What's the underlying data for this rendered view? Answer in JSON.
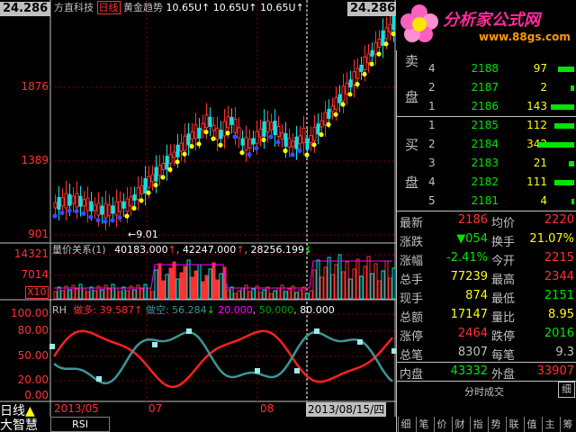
{
  "header": {
    "title_main": "方直科技",
    "title_period": "日线",
    "title_indicator": "黄金趋势",
    "title_values": [
      "10.65U↑",
      "10.65U↑",
      "10.65U↑"
    ],
    "top_left_badge": "24.286",
    "top_right_badge": "24.286"
  },
  "watermark": {
    "title": "分析家公式网",
    "url": "www.88gs.com"
  },
  "price_axis": [
    "1876",
    "1389",
    "901"
  ],
  "low_marker": "←9.01",
  "volume_panel": {
    "title": "量价关系(1)",
    "v1": "40183.000",
    "v2": "42247.000",
    "v3": "28256.199",
    "axis_top": "14321",
    "axis_mid": "7014",
    "axis_unit": "X10"
  },
  "rsi_panel": {
    "name": "RH",
    "label1": "做多:",
    "value1": "39.587",
    "label2": "做空:",
    "value2": "56.284",
    "v3": "20.000",
    "v4": "50.000",
    "v5": "80.000",
    "axis": [
      "100.00",
      "80.00",
      "50.00",
      "20.00",
      "0.00"
    ]
  },
  "bottom": {
    "period_label": "日线",
    "company_label": "大智慧",
    "indicator_tab": "RSI",
    "date1": "2013/05",
    "date2": "07",
    "date3": "08",
    "cursor_date": "2013/08/15/四"
  },
  "order_book": {
    "sell_label": [
      "卖",
      "盘"
    ],
    "buy_label": [
      "买",
      "盘"
    ],
    "sell": [
      {
        "level": "4",
        "price": "2188",
        "volume": "97",
        "bar": 18
      },
      {
        "level": "2",
        "price": "2187",
        "volume": "2",
        "bar": 4
      },
      {
        "level": "1",
        "price": "2186",
        "volume": "143",
        "bar": 26
      }
    ],
    "buy": [
      {
        "level": "1",
        "price": "2185",
        "volume": "112",
        "bar": 22
      },
      {
        "level": "2",
        "price": "2184",
        "volume": "342",
        "bar": 40
      },
      {
        "level": "3",
        "price": "2183",
        "volume": "21",
        "bar": 6
      },
      {
        "level": "4",
        "price": "2182",
        "volume": "111",
        "bar": 22
      },
      {
        "level": "5",
        "price": "2181",
        "volume": "4",
        "bar": 3
      }
    ]
  },
  "stats": [
    {
      "l1": "最新",
      "v1": "2186",
      "c1": "red",
      "l2": "均价",
      "v2": "2220",
      "c2": "red"
    },
    {
      "l1": "涨跌",
      "v1": "▼054",
      "c1": "green",
      "l2": "换手",
      "v2": "21.07%",
      "c2": "yellow"
    },
    {
      "l1": "涨幅",
      "v1": "-2.41%",
      "c1": "green",
      "l2": "今开",
      "v2": "2215",
      "c2": "red"
    },
    {
      "l1": "总手",
      "v1": "77239",
      "c1": "yellow",
      "l2": "最高",
      "v2": "2344",
      "c2": "red"
    },
    {
      "l1": "现手",
      "v1": "874",
      "c1": "yellow",
      "l2": "最低",
      "v2": "2151",
      "c2": "green"
    },
    {
      "l1": "总额",
      "v1": "17147",
      "c1": "yellow",
      "l2": "量比",
      "v2": "8.95",
      "c2": "yellow"
    },
    {
      "l1": "涨停",
      "v1": "2464",
      "c1": "red",
      "l2": "跌停",
      "v2": "2016",
      "c2": "green"
    },
    {
      "l1": "总笔",
      "v1": "8307",
      "c1": "gray",
      "l2": "每笔",
      "v2": "9.3",
      "c2": "gray"
    },
    {
      "l1": "内盘",
      "v1": "43332",
      "c1": "green",
      "l2": "外盘",
      "v2": "33907",
      "c2": "red"
    }
  ],
  "time_share": {
    "label": "分时成交",
    "side_button": "细"
  },
  "tabs": [
    "细",
    "笔",
    "价",
    "财",
    "指",
    "势",
    "联",
    "值",
    "主",
    "筹"
  ]
}
